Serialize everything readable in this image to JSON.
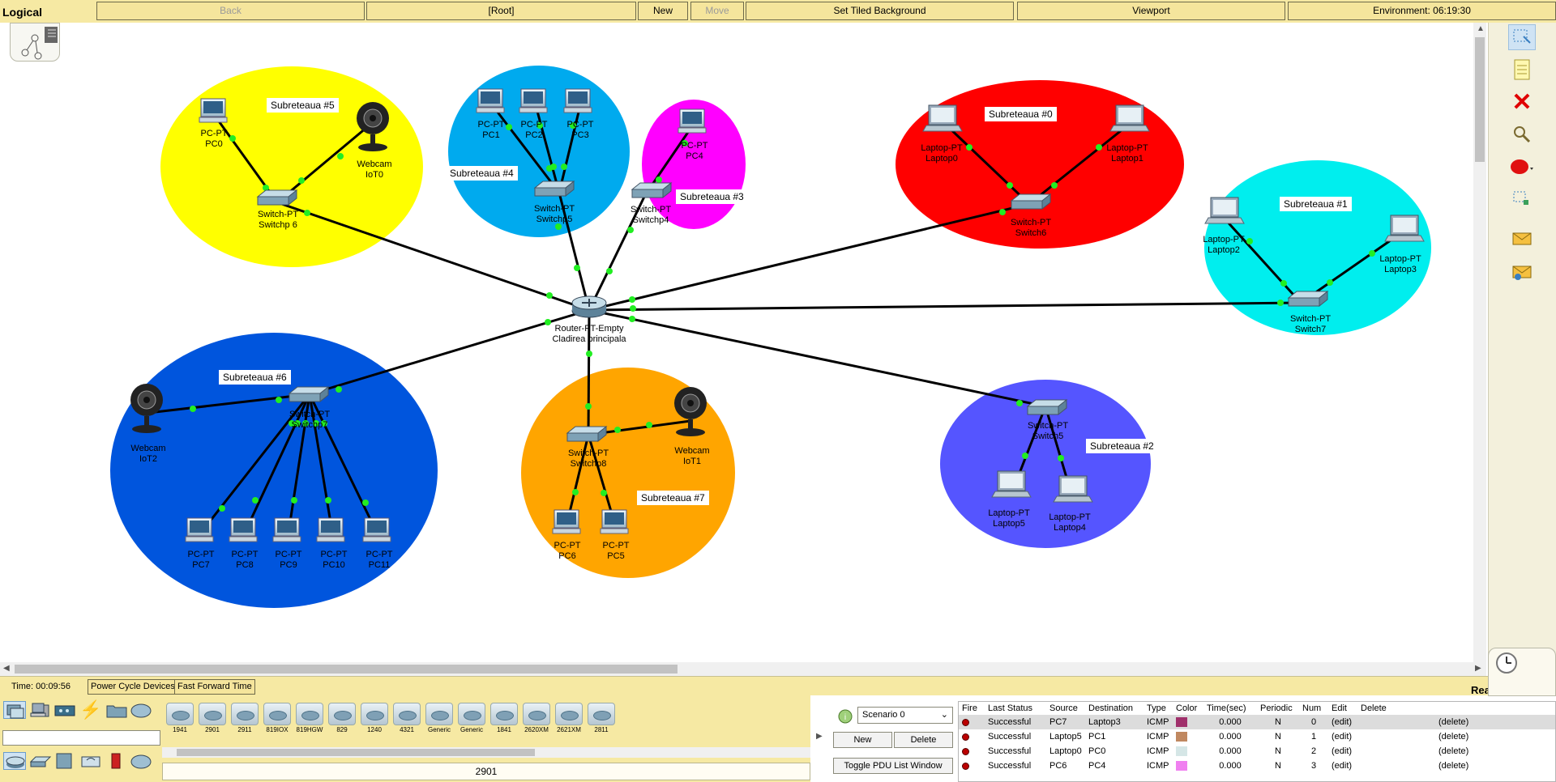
{
  "topbar": {
    "mode": "Logical",
    "back": "Back",
    "root": "[Root]",
    "new_cluster": "New Cluster",
    "move_object": "Move Object",
    "set_tiled_background": "Set Tiled Background",
    "viewport": "Viewport",
    "environment": "Environment: 06:19:30"
  },
  "subnets": {
    "s5": "Subreteaua #5",
    "s4": "Subreteaua #4",
    "s3": "Subreteaua #3",
    "s0": "Subreteaua #0",
    "s1": "Subreteaua #1",
    "s6": "Subreteaua #6",
    "s7": "Subreteaua #7",
    "s2": "Subreteaua #2"
  },
  "devices": {
    "pc0": [
      "PC-PT",
      "PC0"
    ],
    "iot0": [
      "Webcam",
      "IoT0"
    ],
    "sw6y": [
      "Switch-PT",
      "Switchp 6"
    ],
    "pc1": [
      "PC-PT",
      "PC1"
    ],
    "pc2": [
      "PC-PT",
      "PC2"
    ],
    "pc3": [
      "PC-PT",
      "PC3"
    ],
    "sw5b": [
      "Switch-PT",
      "Switchp5"
    ],
    "pc4": [
      "PC-PT",
      "PC4"
    ],
    "sw4": [
      "Switch-PT",
      "Switchp4"
    ],
    "laptop0": [
      "Laptop-PT",
      "Laptop0"
    ],
    "laptop1": [
      "Laptop-PT",
      "Laptop1"
    ],
    "sw6r": [
      "Switch-PT",
      "Switch6"
    ],
    "laptop2": [
      "Laptop-PT",
      "Laptop2"
    ],
    "laptop3": [
      "Laptop-PT",
      "Laptop3"
    ],
    "sw7": [
      "Switch-PT",
      "Switch7"
    ],
    "router": [
      "Router-PT-Empty",
      "Cladirea principala"
    ],
    "iot2": [
      "Webcam",
      "IoT2"
    ],
    "sw7b": [
      "Switch-PT",
      "Switchp7"
    ],
    "pc7": [
      "PC-PT",
      "PC7"
    ],
    "pc8": [
      "PC-PT",
      "PC8"
    ],
    "pc9": [
      "PC-PT",
      "PC9"
    ],
    "pc10": [
      "PC-PT",
      "PC10"
    ],
    "pc11": [
      "PC-PT",
      "PC11"
    ],
    "sw8": [
      "Switch-PT",
      "Switchp8"
    ],
    "iot1": [
      "Webcam",
      "IoT1"
    ],
    "pc6": [
      "PC-PT",
      "PC6"
    ],
    "pc5": [
      "PC-PT",
      "PC5"
    ],
    "sw5": [
      "Switch-PT",
      "Switch5"
    ],
    "laptop5": [
      "Laptop-PT",
      "Laptop5"
    ],
    "laptop4": [
      "Laptop-PT",
      "Laptop4"
    ]
  },
  "subnet_colors": {
    "s5": "#ffff00",
    "s4": "#00aaee",
    "s3": "#ff00ff",
    "s0": "#ff0000",
    "s1": "#00eeee",
    "s6": "#0055dd",
    "s7": "#ffa500",
    "s2": "#5555ff"
  },
  "timebar": {
    "time": "Time: 00:09:56",
    "power_cycle": "Power Cycle Devices",
    "fast_forward": "Fast Forward Time",
    "realtime": "Realtime"
  },
  "device_models": [
    "1941",
    "2901",
    "2911",
    "819IOX",
    "819HGW",
    "829",
    "1240",
    "4321",
    "Generic",
    "Generic",
    "1841",
    "2620XM",
    "2621XM",
    "2811"
  ],
  "selected_model": "2901",
  "scenario": {
    "selected": "Scenario 0",
    "new": "New",
    "delete": "Delete",
    "toggle": "Toggle PDU List Window"
  },
  "pdu": {
    "headers": [
      "Fire",
      "Last Status",
      "Source",
      "Destination",
      "Type",
      "Color",
      "Time(sec)",
      "Periodic",
      "Num",
      "Edit",
      "Delete"
    ],
    "rows": [
      {
        "status": "Successful",
        "source": "PC7",
        "dest": "Laptop3",
        "type": "ICMP",
        "color": "#a0306b",
        "time": "0.000",
        "periodic": "N",
        "num": "0",
        "edit": "(edit)",
        "delete": "(delete)"
      },
      {
        "status": "Successful",
        "source": "Laptop5",
        "dest": "PC1",
        "type": "ICMP",
        "color": "#c08860",
        "time": "0.000",
        "periodic": "N",
        "num": "1",
        "edit": "(edit)",
        "delete": "(delete)"
      },
      {
        "status": "Successful",
        "source": "Laptop0",
        "dest": "PC0",
        "type": "ICMP",
        "color": "#d5e6e6",
        "time": "0.000",
        "periodic": "N",
        "num": "2",
        "edit": "(edit)",
        "delete": "(delete)"
      },
      {
        "status": "Successful",
        "source": "PC6",
        "dest": "PC4",
        "type": "ICMP",
        "color": "#f080f0",
        "time": "0.000",
        "periodic": "N",
        "num": "3",
        "edit": "(edit)",
        "delete": "(delete)"
      }
    ]
  }
}
